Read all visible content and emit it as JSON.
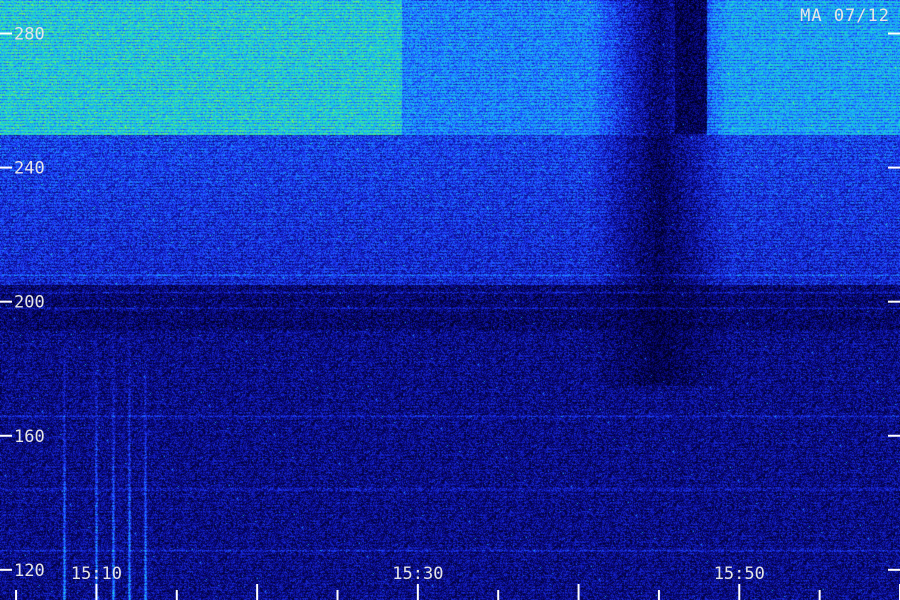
{
  "stamp": "MA 07/12",
  "chart_data": {
    "type": "heatmap",
    "title": "",
    "xlabel": "",
    "ylabel": "",
    "y_ticks": [
      120,
      160,
      200,
      240,
      280
    ],
    "y_tick_labels": [
      "120",
      "160",
      "200",
      "240",
      "280"
    ],
    "x_label_ticks": [
      "15:10",
      "15:30",
      "15:50"
    ],
    "xlim": [
      "15:04",
      "16:00"
    ],
    "ylim": [
      111,
      290
    ],
    "colormap": [
      "#000020",
      "#0a0a8c",
      "#1f3cff",
      "#1aa8ff",
      "#20e0c0",
      "#8aff40"
    ],
    "tick_color": "#ffffff",
    "label_color": "#e6e6e6",
    "intensity_regions": [
      {
        "time_start": "15:04",
        "time_end": "15:29",
        "freq_low": 250,
        "freq_high": 290,
        "level": 0.78
      },
      {
        "time_start": "15:29",
        "time_end": "15:46",
        "freq_low": 250,
        "freq_high": 290,
        "level": 0.58
      },
      {
        "time_start": "15:48",
        "time_end": "16:00",
        "freq_low": 250,
        "freq_high": 290,
        "level": 0.66
      },
      {
        "time_start": "15:04",
        "time_end": "16:00",
        "freq_low": 205,
        "freq_high": 250,
        "level": 0.42
      },
      {
        "time_start": "15:04",
        "time_end": "16:00",
        "freq_low": 111,
        "freq_high": 205,
        "level": 0.2
      }
    ],
    "gaps": [
      {
        "time_start": "15:42",
        "time_end": "15:48",
        "freq_low": 175,
        "freq_high": 290,
        "level": 0.06
      }
    ],
    "vertical_bursts": [
      "15:08",
      "15:10",
      "15:11",
      "15:12",
      "15:13"
    ],
    "horizontal_bands": [
      126,
      144,
      166,
      198,
      203,
      208
    ]
  }
}
